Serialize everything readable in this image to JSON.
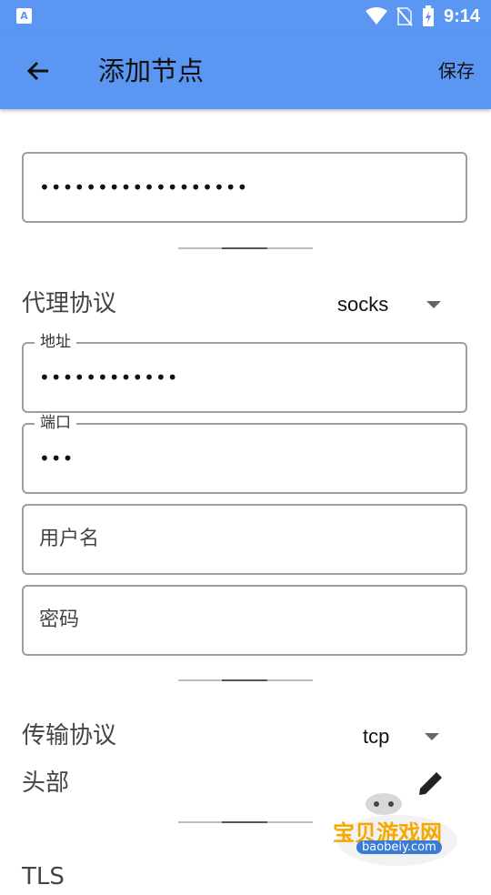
{
  "status_bar": {
    "time": "9:14",
    "app_icon_letter": "A"
  },
  "app_bar": {
    "title": "添加节点",
    "save_label": "保存",
    "back_icon": "arrow-left-icon"
  },
  "form": {
    "remarks_value": "••••••••••••••••••",
    "proxy_protocol": {
      "label": "代理协议",
      "value": "socks"
    },
    "address": {
      "label": "地址",
      "value": "••••••••••••"
    },
    "port": {
      "label": "端口",
      "value": "•••"
    },
    "username": {
      "placeholder": "用户名"
    },
    "password": {
      "placeholder": "密码"
    },
    "transport_protocol": {
      "label": "传输协议",
      "value": "tcp"
    },
    "header": {
      "label": "头部",
      "edit_icon": "pencil-icon"
    },
    "tls_partial": "TLS"
  },
  "watermark": {
    "title": "宝贝游戏网",
    "url": "baobeiy.com"
  },
  "colors": {
    "primary": "#5b96f2",
    "border": "#9e9e9e"
  }
}
